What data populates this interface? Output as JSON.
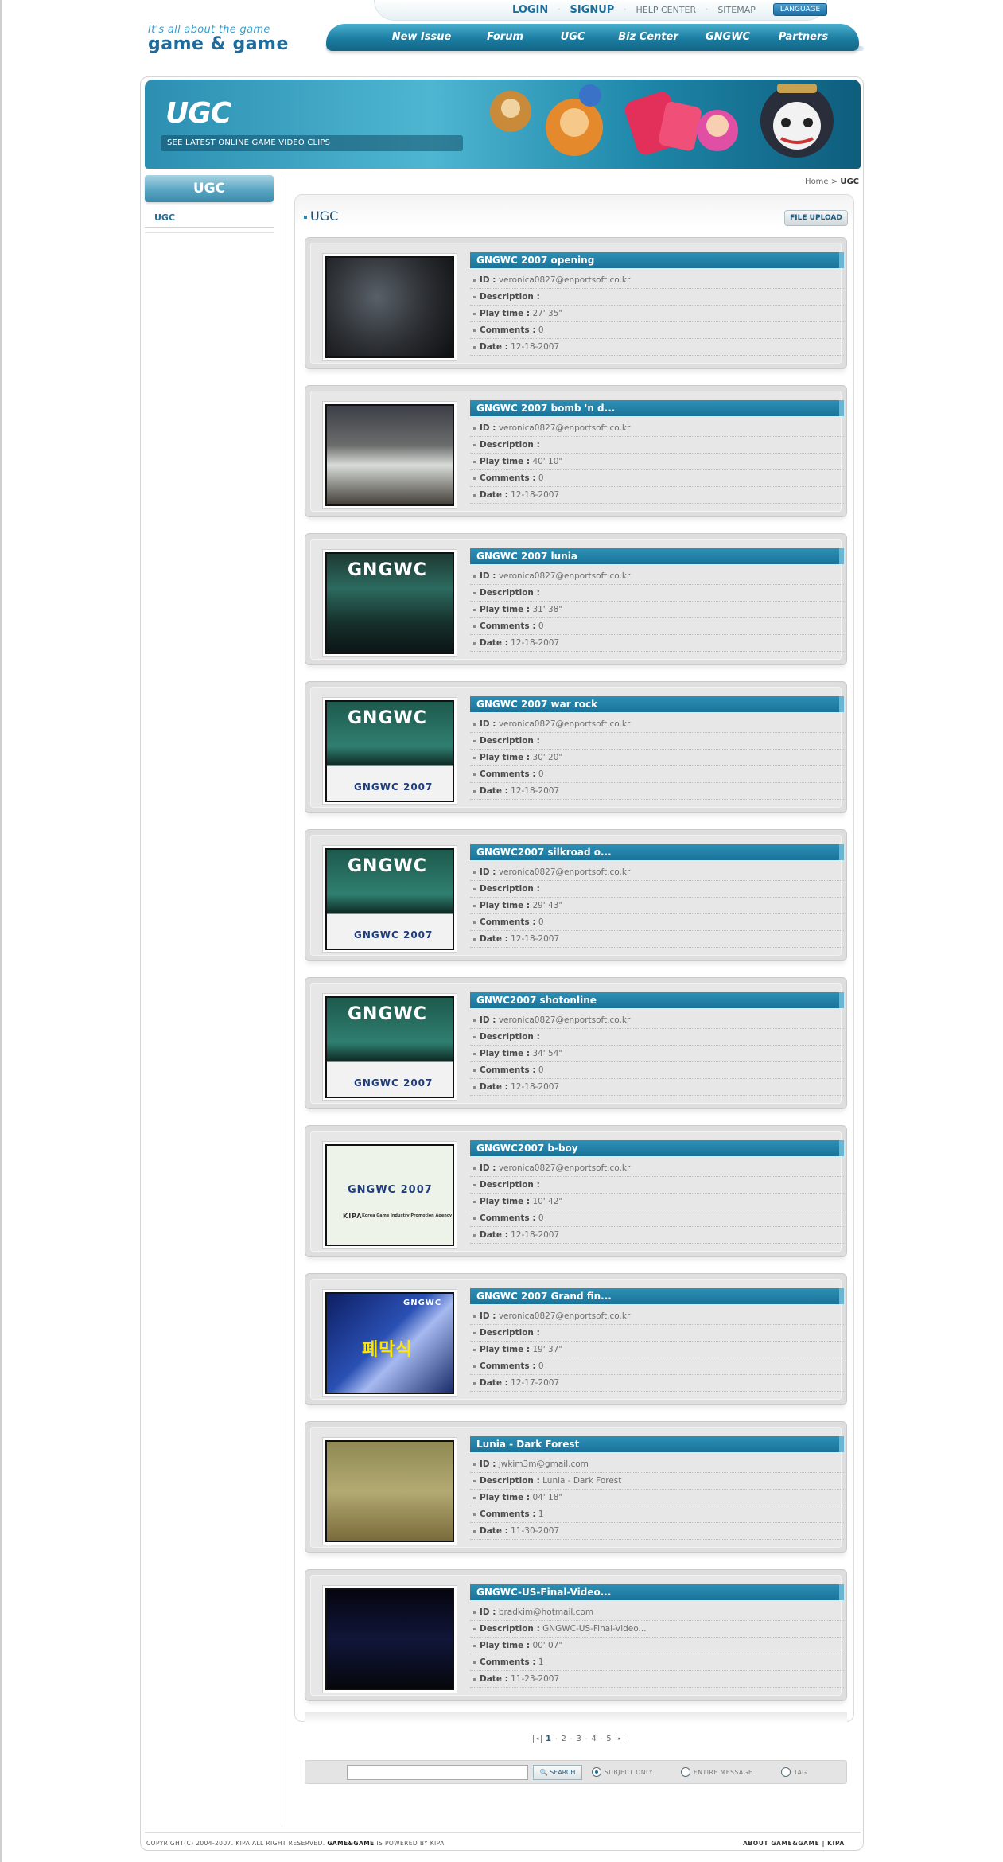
{
  "header": {
    "tagline": "It's all about the game",
    "logo_text": "game & game",
    "top_links": [
      "LOGIN",
      "SIGNUP",
      "HELP CENTER",
      "SITEMAP"
    ],
    "language_label": "LANGUAGE",
    "nav": [
      "New Issue",
      "Forum",
      "UGC",
      "Biz Center",
      "GNGWC",
      "Partners"
    ]
  },
  "banner": {
    "title": "UGC",
    "subtitle": "SEE LATEST ONLINE GAME VIDEO CLIPS"
  },
  "sidebar": {
    "heading": "UGC",
    "items": [
      "UGC"
    ]
  },
  "breadcrumb": {
    "home": "Home",
    "sep": " > ",
    "current": "UGC"
  },
  "main": {
    "title": "UGC",
    "upload_label": "FILE UPLOAD",
    "field_labels": {
      "id": "ID :",
      "description": "Description :",
      "playtime": "Play time :",
      "comments": "Comments :",
      "date": "Date :"
    },
    "clips": [
      {
        "title": "GNGWC 2007 opening",
        "id": "veronica0827@enportsoft.co.kr",
        "description": "",
        "playtime": "27' 35\"",
        "comments": "0",
        "date": "12-18-2007",
        "thumb": "crowd"
      },
      {
        "title": "GNGWC 2007 bomb 'n d...",
        "id": "veronica0827@enportsoft.co.kr",
        "description": "",
        "playtime": "40' 10\"",
        "comments": "0",
        "date": "12-18-2007",
        "thumb": "hall"
      },
      {
        "title": "GNGWC 2007 lunia",
        "id": "veronica0827@enportsoft.co.kr",
        "description": "",
        "playtime": "31' 38\"",
        "comments": "0",
        "date": "12-18-2007",
        "thumb": "stage"
      },
      {
        "title": "GNGWC 2007 war rock",
        "id": "veronica0827@enportsoft.co.kr",
        "description": "",
        "playtime": "30' 20\"",
        "comments": "0",
        "date": "12-18-2007",
        "thumb": "stage2"
      },
      {
        "title": "GNGWC2007 silkroad o...",
        "id": "veronica0827@enportsoft.co.kr",
        "description": "",
        "playtime": "29' 43\"",
        "comments": "0",
        "date": "12-18-2007",
        "thumb": "stage2"
      },
      {
        "title": "GNWC2007 shotonline",
        "id": "veronica0827@enportsoft.co.kr",
        "description": "",
        "playtime": "34' 54\"",
        "comments": "0",
        "date": "12-18-2007",
        "thumb": "stage2"
      },
      {
        "title": "GNGWC2007 b-boy",
        "id": "veronica0827@enportsoft.co.kr",
        "description": "",
        "playtime": "10' 42\"",
        "comments": "0",
        "date": "12-18-2007",
        "thumb": "logo"
      },
      {
        "title": "GNGWC 2007 Grand fin...",
        "id": "veronica0827@enportsoft.co.kr",
        "description": "",
        "playtime": "19' 37\"",
        "comments": "0",
        "date": "12-17-2007",
        "thumb": "closing"
      },
      {
        "title": "Lunia - Dark Forest",
        "id": "jwkim3m@gmail.com",
        "description": "Lunia - Dark Forest",
        "playtime": "04' 18\"",
        "comments": "1",
        "date": "11-30-2007",
        "thumb": "game"
      },
      {
        "title": "GNGWC-US-Final-Video...",
        "id": "bradkim@hotmail.com",
        "description": "GNGWC-US-Final-Video...",
        "playtime": "00' 07\"",
        "comments": "1",
        "date": "11-23-2007",
        "thumb": "dark"
      }
    ],
    "thumb_text": {
      "gngwc": "GNGWC",
      "gngwc_year": "GNGWC 2007",
      "kipa": "KIPA",
      "kipa_full": "Korea Game Industry Promotion Agency",
      "closing": "폐막식"
    }
  },
  "pagination": {
    "pages": [
      "1",
      "2",
      "3",
      "4",
      "5"
    ],
    "current": "1",
    "prev": "◂",
    "next": "▸"
  },
  "search": {
    "input_value": "",
    "button_label": "SEARCH",
    "options": [
      "SUBJECT ONLY",
      "ENTIRE MESSAGE",
      "TAG"
    ],
    "selected": "SUBJECT ONLY"
  },
  "footer": {
    "copyright_prefix": "COPYRIGHT(C) 2004-2007. KIPA ALL RIGHT RESERVED.",
    "brand": "GAME&GAME",
    "powered": "IS POWERED BY KIPA",
    "links": [
      "ABOUT GAME&GAME",
      "KIPA"
    ]
  },
  "colors": {
    "accent": "#1b7da1",
    "title_bar": "#1a7399",
    "link": "#1f6f98"
  }
}
